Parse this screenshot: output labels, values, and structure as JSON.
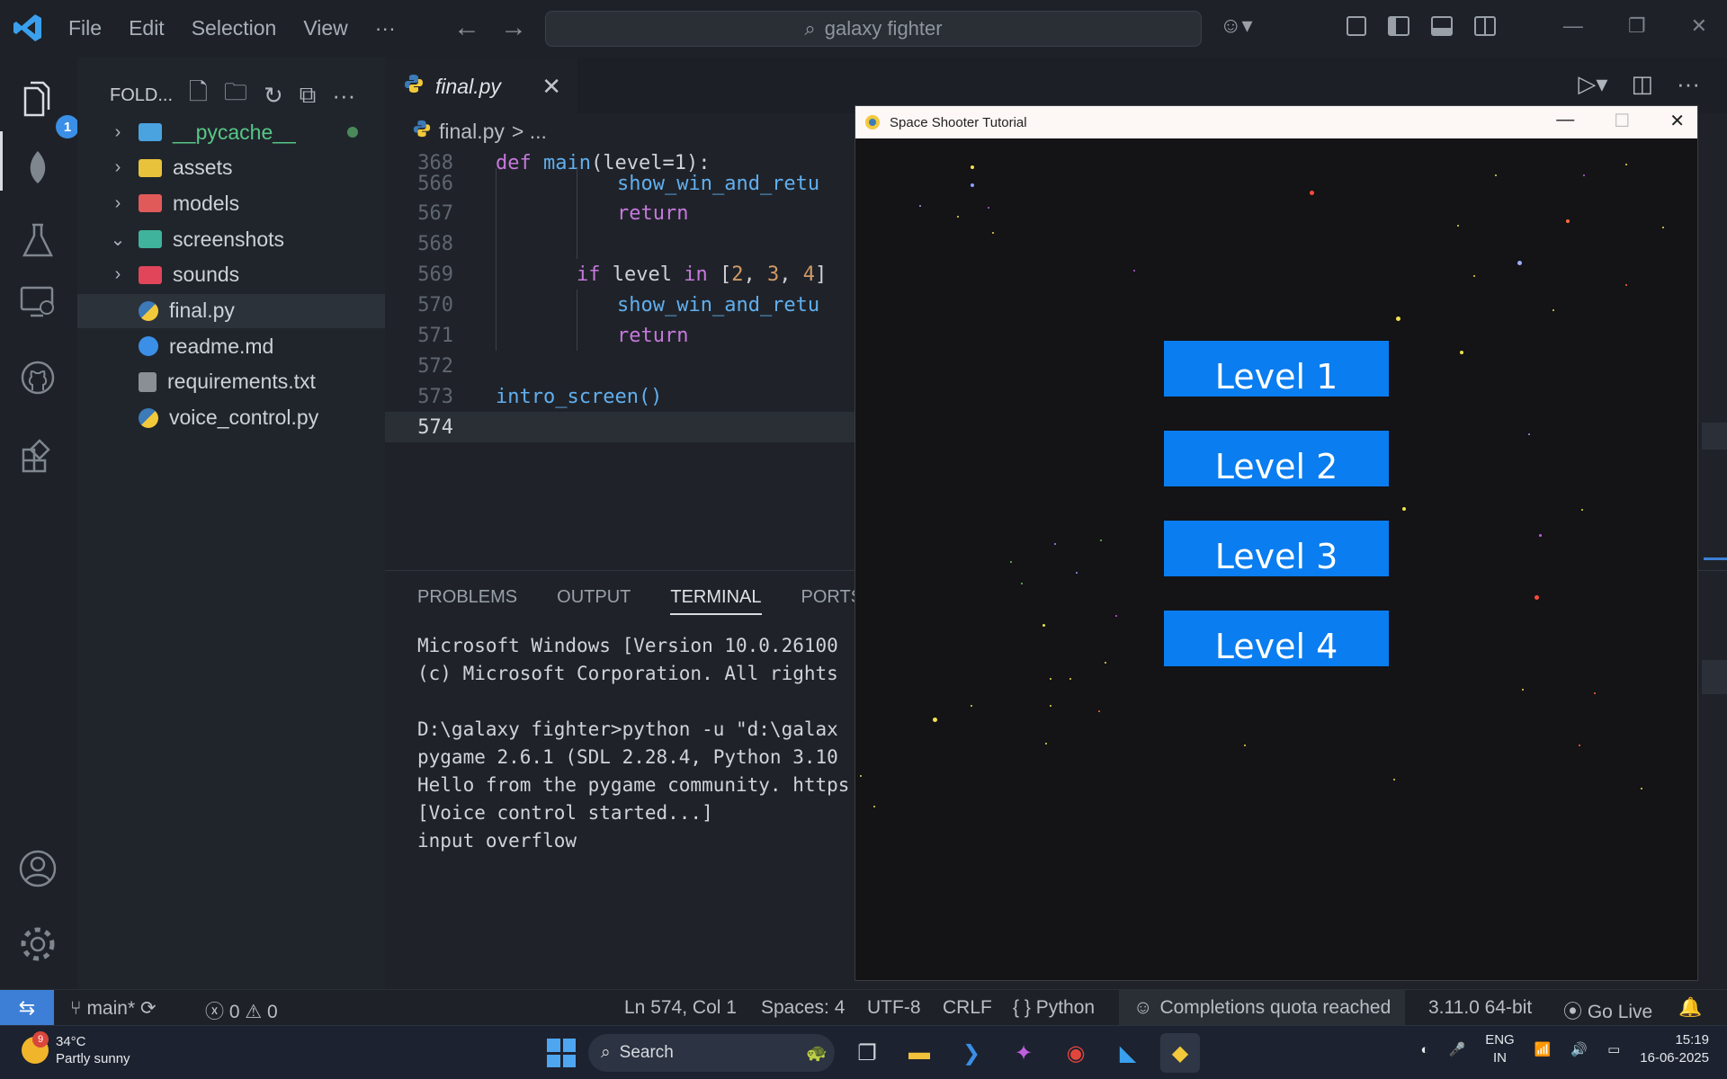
{
  "titlebar": {
    "menus": [
      "File",
      "Edit",
      "Selection",
      "View",
      "···"
    ],
    "search_text": "galaxy fighter"
  },
  "activity": {
    "explorer_badge": "1"
  },
  "sidebar": {
    "header": "FOLD...",
    "items": [
      {
        "label": "__pycache__",
        "type": "folder",
        "color": "#4aa3df",
        "expandable": true,
        "chevron": ">"
      },
      {
        "label": "assets",
        "type": "folder",
        "color": "#e8c23b",
        "expandable": true,
        "chevron": ">"
      },
      {
        "label": "models",
        "type": "folder",
        "color": "#e05a5a",
        "expandable": true,
        "chevron": ">"
      },
      {
        "label": "screenshots",
        "type": "folder",
        "color": "#3fb39b",
        "expandable": true,
        "chevron": "v"
      },
      {
        "label": "sounds",
        "type": "folder",
        "color": "#e0455a",
        "expandable": true,
        "chevron": ">"
      },
      {
        "label": "final.py",
        "type": "python",
        "selected": true
      },
      {
        "label": "readme.md",
        "type": "info"
      },
      {
        "label": "requirements.txt",
        "type": "text"
      },
      {
        "label": "voice_control.py",
        "type": "python"
      }
    ]
  },
  "editor": {
    "tab_label": "final.py",
    "breadcrumb_file": "final.py",
    "breadcrumb_more": "> ...",
    "sticky_line": {
      "num": "368",
      "kw": "def",
      "fn": "main",
      "rest": "(level=1):"
    },
    "lines": [
      {
        "num": "566",
        "code": "show_win_and_retu",
        "indent": 3,
        "kind": "fn"
      },
      {
        "num": "567",
        "code": "return",
        "indent": 3,
        "kind": "kw"
      },
      {
        "num": "568",
        "code": "",
        "indent": 0,
        "kind": "plain"
      },
      {
        "num": "569",
        "code": "level in [2, 3, 4]",
        "indent": 2,
        "kind": "if"
      },
      {
        "num": "570",
        "code": "show_win_and_retu",
        "indent": 3,
        "kind": "fn"
      },
      {
        "num": "571",
        "code": "return",
        "indent": 3,
        "kind": "kw"
      },
      {
        "num": "572",
        "code": "",
        "indent": 0,
        "kind": "plain"
      },
      {
        "num": "573",
        "code": "intro_screen()",
        "indent": 0,
        "kind": "fn"
      },
      {
        "num": "574",
        "code": "",
        "indent": 0,
        "kind": "plain",
        "current": true
      }
    ]
  },
  "panel": {
    "tabs": [
      "PROBLEMS",
      "OUTPUT",
      "TERMINAL",
      "PORTS"
    ],
    "active_tab": "TERMINAL",
    "terminal_lines": [
      "Microsoft Windows [Version 10.0.26100",
      "(c) Microsoft Corporation. All rights",
      "",
      "D:\\galaxy fighter>python -u \"d:\\galax",
      "pygame 2.6.1 (SDL 2.28.4, Python 3.10",
      "Hello from the pygame community. https",
      "[Voice control started...]",
      "input overflow"
    ]
  },
  "game": {
    "title": "Space Shooter Tutorial",
    "buttons": [
      "Level 1",
      "Level 2",
      "Level 3",
      "Level 4"
    ],
    "button_color": "#0a7df0"
  },
  "statusbar": {
    "branch": "main*",
    "errors": "0",
    "warnings": "0",
    "position": "Ln 574, Col 1",
    "spaces": "Spaces: 4",
    "encoding": "UTF-8",
    "eol": "CRLF",
    "language": "Python",
    "quota": "Completions quota reached",
    "interpreter": "3.11.0 64-bit",
    "golive": "Go Live"
  },
  "taskbar": {
    "weather_temp": "34°C",
    "weather_desc": "Partly sunny",
    "weather_badge": "9",
    "search": "Search",
    "lang_top": "ENG",
    "lang_bottom": "IN",
    "time": "15:19",
    "date": "16-06-2025"
  }
}
